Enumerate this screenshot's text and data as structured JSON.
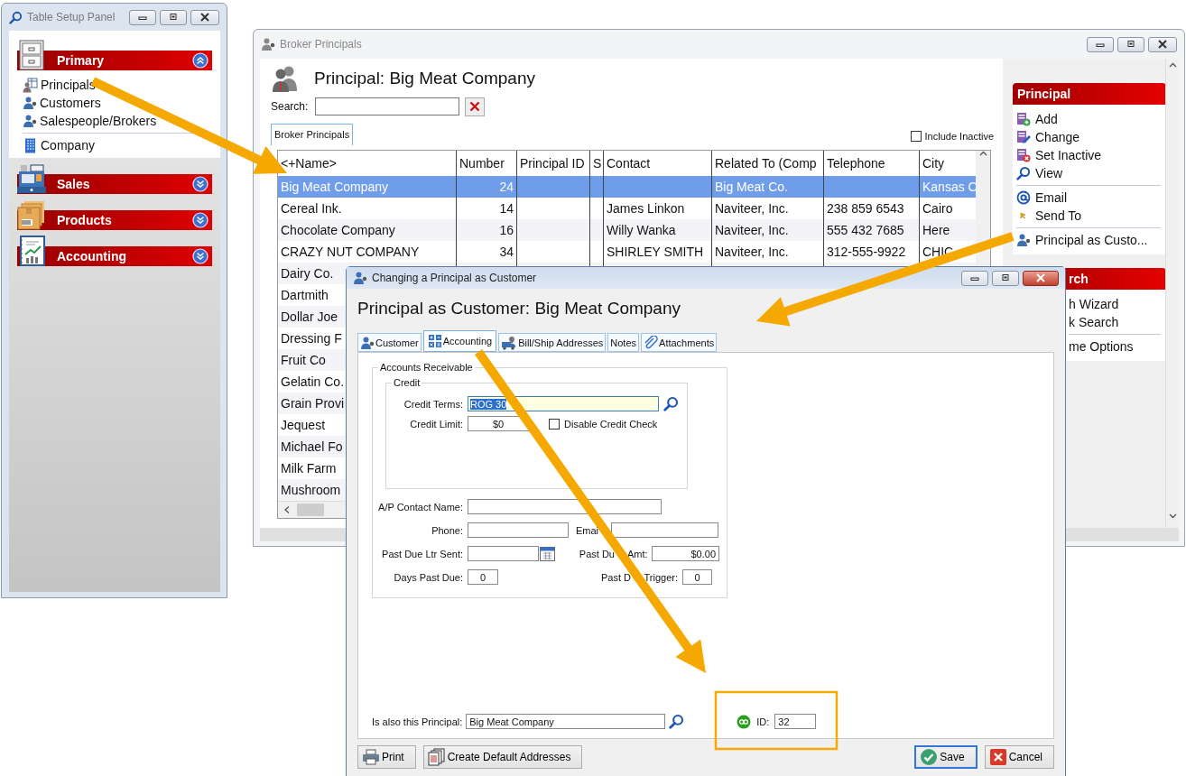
{
  "table_setup_panel": {
    "title": "Table Setup Panel",
    "groups": [
      {
        "label": "Primary",
        "expanded": true,
        "items": [
          {
            "label": "Principals",
            "divider_before": false
          },
          {
            "label": "Customers",
            "divider_before": false
          },
          {
            "label": "Salespeople/Brokers",
            "divider_before": false
          },
          {
            "label": "Company",
            "divider_before": true
          }
        ]
      },
      {
        "label": "Sales",
        "expanded": false
      },
      {
        "label": "Products",
        "expanded": false
      },
      {
        "label": "Accounting",
        "expanded": false
      }
    ]
  },
  "broker_window": {
    "title": "Broker Principals",
    "heading": "Principal: Big Meat Company",
    "search": {
      "label": "Search:"
    },
    "tabs": [
      {
        "label": "Broker Principals",
        "selected": true
      }
    ],
    "include_inactive": {
      "label": "Include Inactive",
      "checked": false
    },
    "table": {
      "columns": [
        "<+Name>",
        "Number",
        "Principal ID",
        "S",
        "Contact",
        "Related To (Comp",
        "Telephone",
        "City"
      ],
      "rows": [
        {
          "selected": true,
          "name": "Big Meat Company",
          "number": "24",
          "related_to": "Big Meat Co.",
          "city": "Kansas C"
        },
        {
          "selected": false,
          "name": "Cereal Ink.",
          "number": "14",
          "contact": "James Linkon",
          "related_to": "Naviteer, Inc.",
          "telephone": "238 859 6543",
          "city": "Cairo"
        },
        {
          "selected": false,
          "name": "Chocolate Company",
          "number": "16",
          "contact": "Willy Wanka",
          "related_to": "Naviteer, Inc.",
          "telephone": "555 432 7685",
          "city": "Here"
        },
        {
          "selected": false,
          "name": "CRAZY NUT COMPANY",
          "number": "34",
          "contact": "SHIRLEY SMITH",
          "related_to": "Naviteer, Inc.",
          "telephone": "312-555-9922",
          "city": "CHIC"
        },
        {
          "selected": false,
          "name": "Dairy Co."
        },
        {
          "selected": false,
          "name": "Dartmith"
        },
        {
          "selected": false,
          "name": "Dollar Joe"
        },
        {
          "selected": false,
          "name": "Dressing F"
        },
        {
          "selected": false,
          "name": "Fruit Co"
        },
        {
          "selected": false,
          "name": "Gelatin Co."
        },
        {
          "selected": false,
          "name": "Grain Provi"
        },
        {
          "selected": false,
          "name": "Jequest"
        },
        {
          "selected": false,
          "name": "Michael Fo"
        },
        {
          "selected": false,
          "name": "Milk Farm"
        },
        {
          "selected": false,
          "name": "Mushroom"
        }
      ]
    },
    "sidebar": {
      "sections": [
        {
          "kind": "full",
          "title": "Principal",
          "items": [
            {
              "label": "Add",
              "divider_before": false
            },
            {
              "label": "Change",
              "divider_before": false
            },
            {
              "label": "Set Inactive",
              "divider_before": false
            },
            {
              "label": "View",
              "divider_before": false
            },
            {
              "label": "Email",
              "divider_before": true
            },
            {
              "label": "Send To",
              "divider_before": false
            },
            {
              "label": "Principal as Custo...",
              "divider_before": true
            }
          ]
        },
        {
          "kind": "partial",
          "title": "rch",
          "items": [
            {
              "label": "h Wizard",
              "divider_before": false
            },
            {
              "label": "k Search",
              "divider_before": false
            },
            {
              "label": "me Options",
              "divider_before": true
            }
          ]
        }
      ]
    }
  },
  "dialog": {
    "title": "Changing a Principal as Customer",
    "heading": "Principal as Customer: Big Meat Company",
    "tabs": [
      {
        "label": "Customer",
        "selected": false
      },
      {
        "label": "Accounting",
        "selected": true
      },
      {
        "label": "Bill/Ship Addresses",
        "selected": false
      },
      {
        "label": "Notes",
        "selected": false
      },
      {
        "label": "Attachments",
        "selected": false
      }
    ],
    "accounts_receivable": {
      "title": "Accounts Receivable",
      "credit": {
        "title": "Credit",
        "credit_terms": {
          "label": "Credit Terms:",
          "value": "ROG 30"
        },
        "credit_limit": {
          "label": "Credit Limit:",
          "value": "$0"
        },
        "disable_credit_check": {
          "label": "Disable Credit Check",
          "checked": false
        }
      },
      "ap_contact_name": {
        "label": "A/P Contact Name:"
      },
      "phone": {
        "label": "Phone:"
      },
      "email": {
        "label": "Emai"
      },
      "past_due_ltr_sent": {
        "label": "Past Due Ltr Sent:"
      },
      "past_due_amt": {
        "label_parts": [
          "Past Du",
          "Amt:"
        ],
        "value": "$0.00"
      },
      "days_past_due": {
        "label": "Days Past Due:",
        "value": "0"
      },
      "past_due_trigger": {
        "label_parts": [
          "Past D",
          "Trigger:"
        ],
        "value": "0"
      }
    },
    "is_also_principal": {
      "label": "Is also this Principal:",
      "value": "Big Meat Company"
    },
    "id_field": {
      "label": "ID:",
      "value": "32"
    },
    "buttons": [
      {
        "label": "Print",
        "focused": false
      },
      {
        "label": "Create Default Addresses",
        "focused": false
      },
      {
        "label": "Save",
        "focused": true
      },
      {
        "label": "Cancel",
        "focused": false
      }
    ]
  }
}
